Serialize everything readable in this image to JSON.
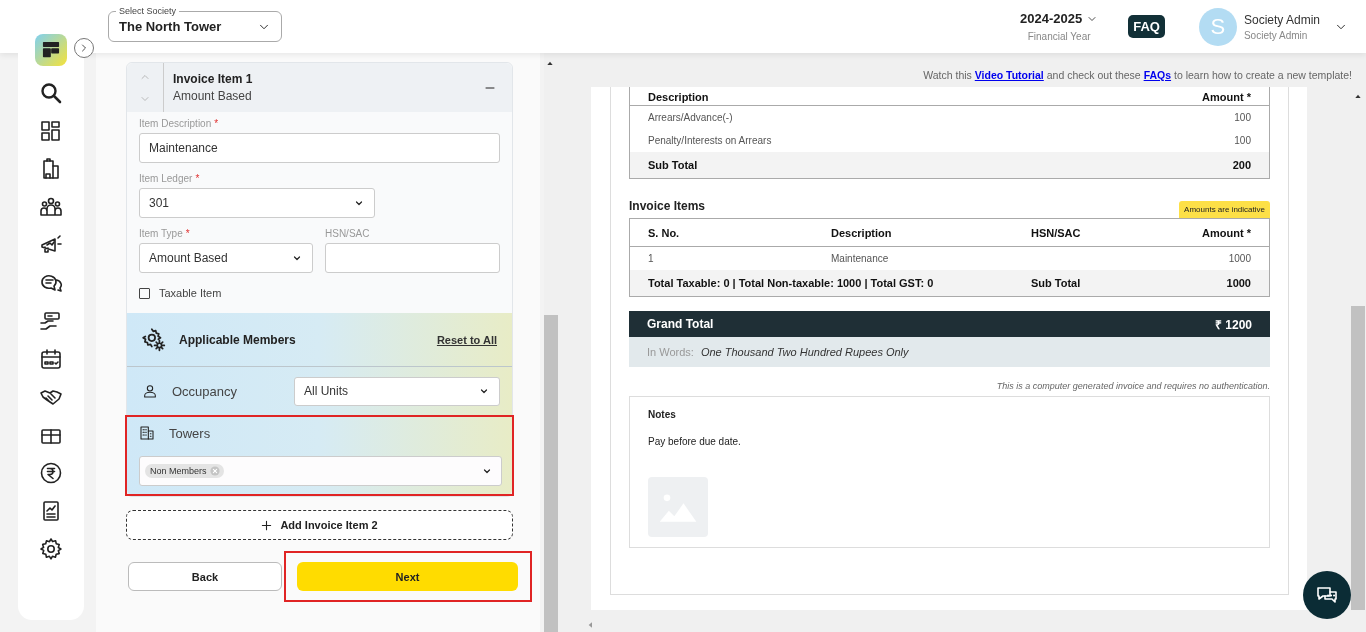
{
  "header": {
    "society_select": {
      "label": "Select Society",
      "value": "The North Tower"
    },
    "financial_year": {
      "value": "2024-2025",
      "label": "Financial Year"
    },
    "faq": "FAQ",
    "user": {
      "initial": "S",
      "name": "Society Admin",
      "role": "Society Admin"
    }
  },
  "invoice_item": {
    "title": "Invoice Item 1",
    "subtitle": "Amount Based",
    "expanded": true,
    "fields": [
      {
        "kind": "text",
        "label": "Item Description",
        "required_mark": "*",
        "value": "Maintenance"
      },
      {
        "kind": "select",
        "label": "Item Ledger",
        "required_mark": "*",
        "value": "301"
      },
      {
        "kind": "select",
        "label": "Item Type",
        "required_mark": "*",
        "value": "Amount Based"
      },
      {
        "kind": "text",
        "label": "HSN/SAC"
      }
    ],
    "taxable": {
      "label": "Taxable Item",
      "checked": false
    },
    "applicable_members": {
      "title": "Applicable Members",
      "reset_link": "Reset to All",
      "occupancy": {
        "label": "Occupancy",
        "value": "All Units"
      },
      "towers": {
        "label": "Towers",
        "tags": [
          "Non Members"
        ],
        "highlighted": true
      }
    }
  },
  "add_item_button": "Add Invoice Item 2",
  "actions": [
    {
      "kind": "secondary",
      "label": "Back",
      "highlighted": false
    },
    {
      "kind": "primary",
      "label": "Next",
      "highlighted": true
    }
  ],
  "preview": {
    "help": [
      {
        "kind": "text",
        "text": "Watch this "
      },
      {
        "kind": "link",
        "text": "Video Tutorial"
      },
      {
        "kind": "text",
        "text": " and check out these "
      },
      {
        "kind": "link",
        "text": "FAQs"
      },
      {
        "kind": "text",
        "text": " to learn how to create a new template!"
      }
    ],
    "arrears_table": {
      "columns": [
        "Description",
        "Amount *"
      ],
      "rows": [
        [
          "Arrears/Advance(-)",
          "100"
        ],
        [
          "Penalty/Interests on Arrears",
          "100"
        ]
      ],
      "total": [
        "Sub Total",
        "200"
      ]
    },
    "invoice_items": {
      "title": "Invoice Items",
      "badge": "Amounts are indicative",
      "columns": [
        "S. No.",
        "Description",
        "HSN/SAC",
        "Amount *"
      ],
      "rows": [
        [
          "1",
          "Maintenance",
          "",
          "1000"
        ]
      ],
      "footer": {
        "summary": "Total Taxable: 0 | Total Non-taxable: 1000 | Total GST: 0",
        "label": "Sub Total",
        "value": "1000"
      }
    },
    "grand_total": {
      "label": "Grand Total",
      "value": "₹ 1200"
    },
    "in_words": {
      "label": "In Words:",
      "value": "One Thousand Two Hundred Rupees Only"
    },
    "disclaimer": "This is a computer generated invoice and requires no authentication.",
    "notes": {
      "title": "Notes",
      "text": "Pay before due date."
    }
  }
}
